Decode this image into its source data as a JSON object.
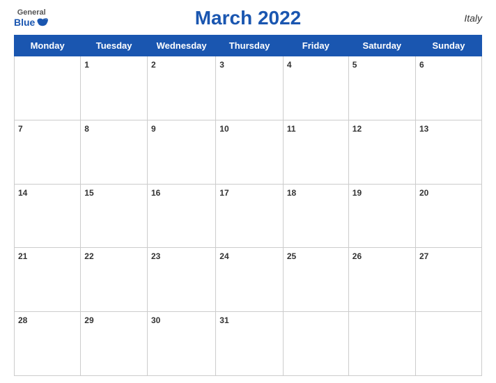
{
  "header": {
    "logo": {
      "general": "General",
      "blue": "Blue"
    },
    "title": "March 2022",
    "country": "Italy"
  },
  "weekdays": [
    "Monday",
    "Tuesday",
    "Wednesday",
    "Thursday",
    "Friday",
    "Saturday",
    "Sunday"
  ],
  "weeks": [
    [
      null,
      "1",
      "2",
      "3",
      "4",
      "5",
      "6"
    ],
    [
      "7",
      "8",
      "9",
      "10",
      "11",
      "12",
      "13"
    ],
    [
      "14",
      "15",
      "16",
      "17",
      "18",
      "19",
      "20"
    ],
    [
      "21",
      "22",
      "23",
      "24",
      "25",
      "26",
      "27"
    ],
    [
      "28",
      "29",
      "30",
      "31",
      null,
      null,
      null
    ]
  ],
  "colors": {
    "header_bg": "#1a56b0",
    "header_text": "#ffffff",
    "title": "#1a56b0"
  }
}
